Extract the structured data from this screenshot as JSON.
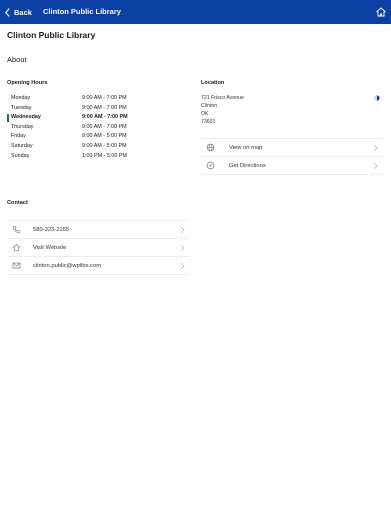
{
  "navbar": {
    "back_label": "Back",
    "title": "Clinton Public Library"
  },
  "page": {
    "title": "Clinton Public Library",
    "about_label": "About"
  },
  "opening_hours": {
    "heading": "Opening Hours",
    "days": [
      {
        "day": "Monday",
        "time": "9:00 AM - 7:00 PM"
      },
      {
        "day": "Tuesday",
        "time": "9:00 AM - 7:00 PM"
      },
      {
        "day": "Wednesday",
        "time": "9:00 AM - 7:00 PM"
      },
      {
        "day": "Thursday",
        "time": "9:00 AM - 7:00 PM"
      },
      {
        "day": "Friday",
        "time": "9:00 AM - 5:00 PM"
      },
      {
        "day": "Saturday",
        "time": "9:00 AM - 5:00 PM"
      },
      {
        "day": "Sunday",
        "time": "1:00 PM - 5:00 PM"
      }
    ]
  },
  "location": {
    "heading": "Location",
    "address_lines": [
      "721 Frisco Avenue",
      "Clinton",
      "OK",
      "73601"
    ],
    "actions": [
      {
        "label": "View on map",
        "icon": "globe-icon"
      },
      {
        "label": "Get Directions",
        "icon": "compass-icon"
      }
    ]
  },
  "contact": {
    "heading": "Contact",
    "items": [
      {
        "label": "580-323-2165",
        "icon": "phone-icon"
      },
      {
        "label": "Visit Website",
        "icon": "home-icon"
      },
      {
        "label": "clinton.public@wplibs.com",
        "icon": "mail-icon"
      }
    ]
  },
  "colors": {
    "nav_bg": "#0a3fa3",
    "today_marker": "#1e7d2d"
  }
}
